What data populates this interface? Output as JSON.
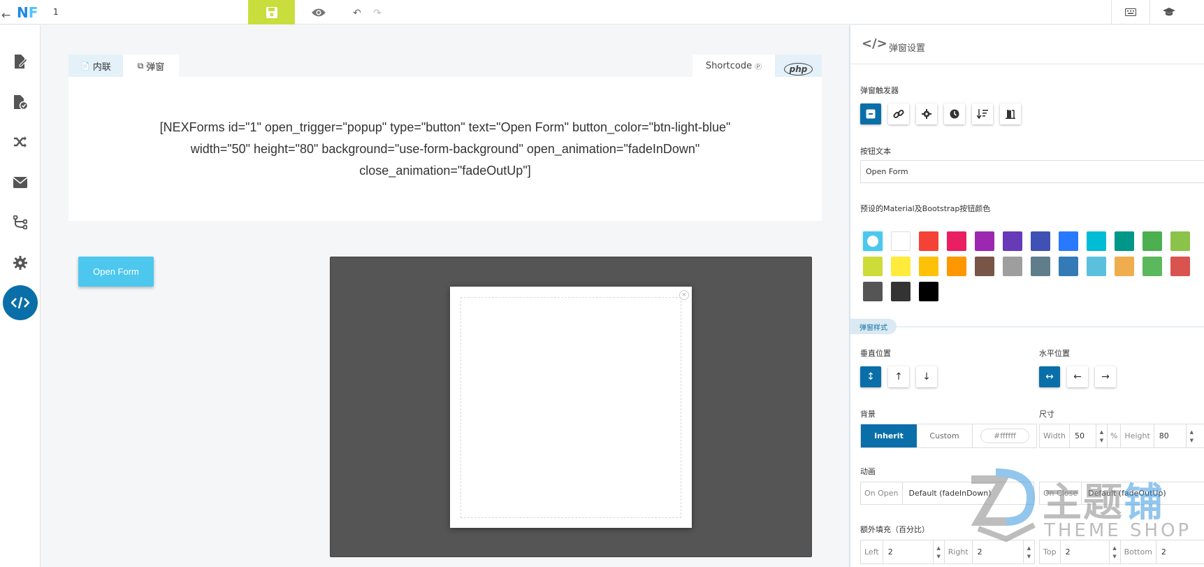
{
  "topbar": {
    "form_id": "1",
    "menu_icons": [
      "keyboard-icon",
      "graduation-cap-icon"
    ]
  },
  "sidebar": {
    "items": [
      {
        "icon": "file-edit-icon"
      },
      {
        "icon": "file-check-icon"
      },
      {
        "icon": "shuffle-icon"
      },
      {
        "icon": "envelope-icon"
      },
      {
        "icon": "route-icon"
      },
      {
        "icon": "gear-icon"
      },
      {
        "icon": "code-icon",
        "active": true
      }
    ]
  },
  "tabs": {
    "inline_label": "内联",
    "popup_label": "弹窗",
    "shortcode_label": "Shortcode",
    "php_label": "php"
  },
  "shortcode_text": "[NEXForms id=\"1\" open_trigger=\"popup\" type=\"button\" text=\"Open Form\" button_color=\"btn-light-blue\" width=\"50\" height=\"80\" background=\"use-form-background\" open_animation=\"fadeInDown\" close_animation=\"fadeOutUp\"]",
  "preview": {
    "open_button_label": "Open Form",
    "stage_color": "#555555",
    "close_glyph": "×"
  },
  "panel": {
    "title": "弹窗设置",
    "trigger_label": "弹窗触发器",
    "button_text_label": "按钮文本",
    "button_text_value": "Open Form",
    "colors_label": "预设的Material及Bootstrap按钮颜色",
    "swatches": [
      "#4dc7ee",
      "#ffffff",
      "#f44336",
      "#e91e63",
      "#9c27b0",
      "#673ab7",
      "#3f51b5",
      "#2979ff",
      "#00bcd4",
      "#009688",
      "#4caf50",
      "#8bc34a",
      "#cddc39",
      "#ffeb3b",
      "#ffc107",
      "#ff9800",
      "#795548",
      "#9e9e9e",
      "#607d8b",
      "#337ab7",
      "#5bc0de",
      "#f0ad4e",
      "#5cb85c",
      "#d9534f",
      "#555555",
      "#333333",
      "#000000"
    ],
    "section_style": "弹窗样式",
    "vertical_label": "垂直位置",
    "horizontal_label": "水平位置",
    "background_label": "背景",
    "bg_inherit": "Inherit",
    "bg_custom": "Custom",
    "bg_color_value": "#ffffff",
    "size_label": "尺寸",
    "width_label": "Width",
    "width_value": "50",
    "percent": "%",
    "height_label": "Height",
    "height_value": "80",
    "animation_label": "动画",
    "on_open_label": "On Open",
    "on_open_value": "Default (fadeInDown)",
    "on_close_label": "On Close",
    "on_close_value": "Default (fadeOutUp)",
    "padding_label": "额外填充（百分比）",
    "left_label": "Left",
    "left_value": "2",
    "right_label": "Right",
    "right_value": "2",
    "top_label": "Top",
    "top_value": "2",
    "bottom_label": "Bottom",
    "bottom_value": "2"
  },
  "watermark": {
    "cn_part1": "主题",
    "cn_part2": "铺",
    "en": "THEME SHOP"
  }
}
